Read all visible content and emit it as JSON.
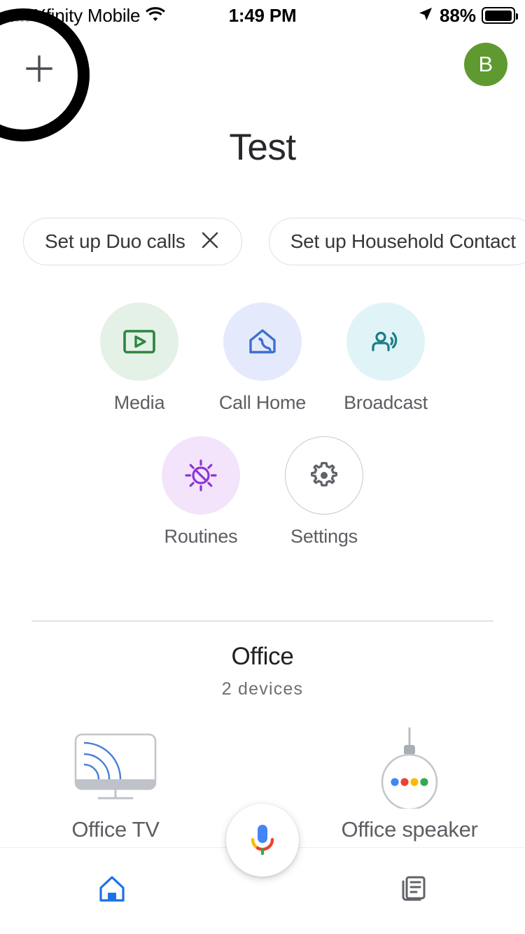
{
  "status_bar": {
    "carrier": "Xfinity Mobile",
    "wifi_icon": "wifi-icon",
    "time": "1:49 PM",
    "location_icon": "location-arrow-icon",
    "battery_percent": "88%",
    "battery_icon": "battery-icon"
  },
  "header": {
    "add_icon": "plus-icon",
    "add_label": "Add",
    "avatar_initial": "B",
    "avatar_color": "#5f9a31",
    "highlight_ring": "highlight-ring-annotation"
  },
  "home": {
    "title": "Test"
  },
  "chips": [
    {
      "label": "Set up Duo calls",
      "dismiss_icon": "close-icon",
      "dismissible": true
    },
    {
      "label": "Set up Household Contact",
      "dismissible": false
    }
  ],
  "actions": [
    {
      "label": "Media",
      "icon": "media-play-icon",
      "icon_color": "#2e8540",
      "bg_color": "#e4f1e6"
    },
    {
      "label": "Call Home",
      "icon": "call-home-icon",
      "icon_color": "#3d6fd0",
      "bg_color": "#e4eafb"
    },
    {
      "label": "Broadcast",
      "icon": "broadcast-icon",
      "icon_color": "#1d7e85",
      "bg_color": "#e0f4f8"
    },
    {
      "label": "Routines",
      "icon": "routines-sun-icon",
      "icon_color": "#8b35d6",
      "bg_color": "#f3e4fb"
    },
    {
      "label": "Settings",
      "icon": "gear-icon",
      "icon_color": "#5f6368",
      "bg_color": "#ffffff"
    }
  ],
  "room": {
    "name": "Office",
    "device_count": "2 devices",
    "devices": [
      {
        "label": "Office TV",
        "icon": "cast-tv-icon"
      },
      {
        "label": "Office speaker",
        "icon": "google-home-speaker-icon"
      }
    ]
  },
  "assistant": {
    "fab_icon": "google-assistant-mic-icon",
    "fab_label": "Google Assistant"
  },
  "bottom_nav": [
    {
      "label": "Home",
      "icon": "home-icon",
      "active": true,
      "color": "#1a73e8"
    },
    {
      "label": "Feed",
      "icon": "feed-icon",
      "active": false,
      "color": "#5f6368"
    }
  ]
}
